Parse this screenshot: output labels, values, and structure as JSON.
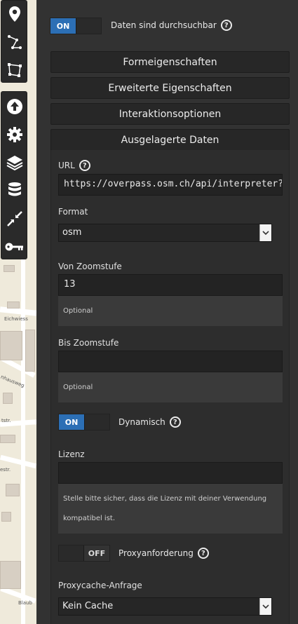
{
  "map": {
    "street_labels": [
      "Eichwiess",
      "nhausweg",
      "tstr.",
      "estr.",
      "Blaub"
    ]
  },
  "toolbar": {
    "top_group": [
      "marker-icon",
      "polyline-icon",
      "polygon-icon"
    ],
    "bottom_group": [
      "upload-icon",
      "gear-icon",
      "layers-icon",
      "database-icon",
      "compress-icon",
      "key-icon"
    ]
  },
  "panel": {
    "searchable": {
      "state": "ON",
      "label": "Daten sind durchsuchbar"
    },
    "sections": {
      "form_props": "Formeigenschaften",
      "advanced_props": "Erweiterte Eigenschaften",
      "interaction": "Interaktionsoptionen",
      "remote_data": "Ausgelagerte Daten"
    },
    "url": {
      "label": "URL",
      "value": "https://overpass.osm.ch/api/interpreter?data=[o"
    },
    "format": {
      "label": "Format",
      "value": "osm"
    },
    "from_zoom": {
      "label": "Von Zoomstufe",
      "value": "13",
      "hint": "Optional"
    },
    "to_zoom": {
      "label": "Bis Zoomstufe",
      "value": "",
      "hint": "Optional"
    },
    "dynamic": {
      "state": "ON",
      "label": "Dynamisch"
    },
    "license": {
      "label": "Lizenz",
      "value": "",
      "hint_line1": "Stelle bitte sicher, dass die Lizenz mit deiner Verwendung",
      "hint_line2": "kompatibel ist."
    },
    "proxy": {
      "state": "OFF",
      "label": "Proxyanforderung"
    },
    "proxy_cache": {
      "label": "Proxycache-Anfrage",
      "value": "Kein Cache"
    }
  },
  "colors": {
    "panel_bg": "#323232",
    "toggle_on": "#2c6fb5",
    "map_bg": "#efeadb"
  }
}
